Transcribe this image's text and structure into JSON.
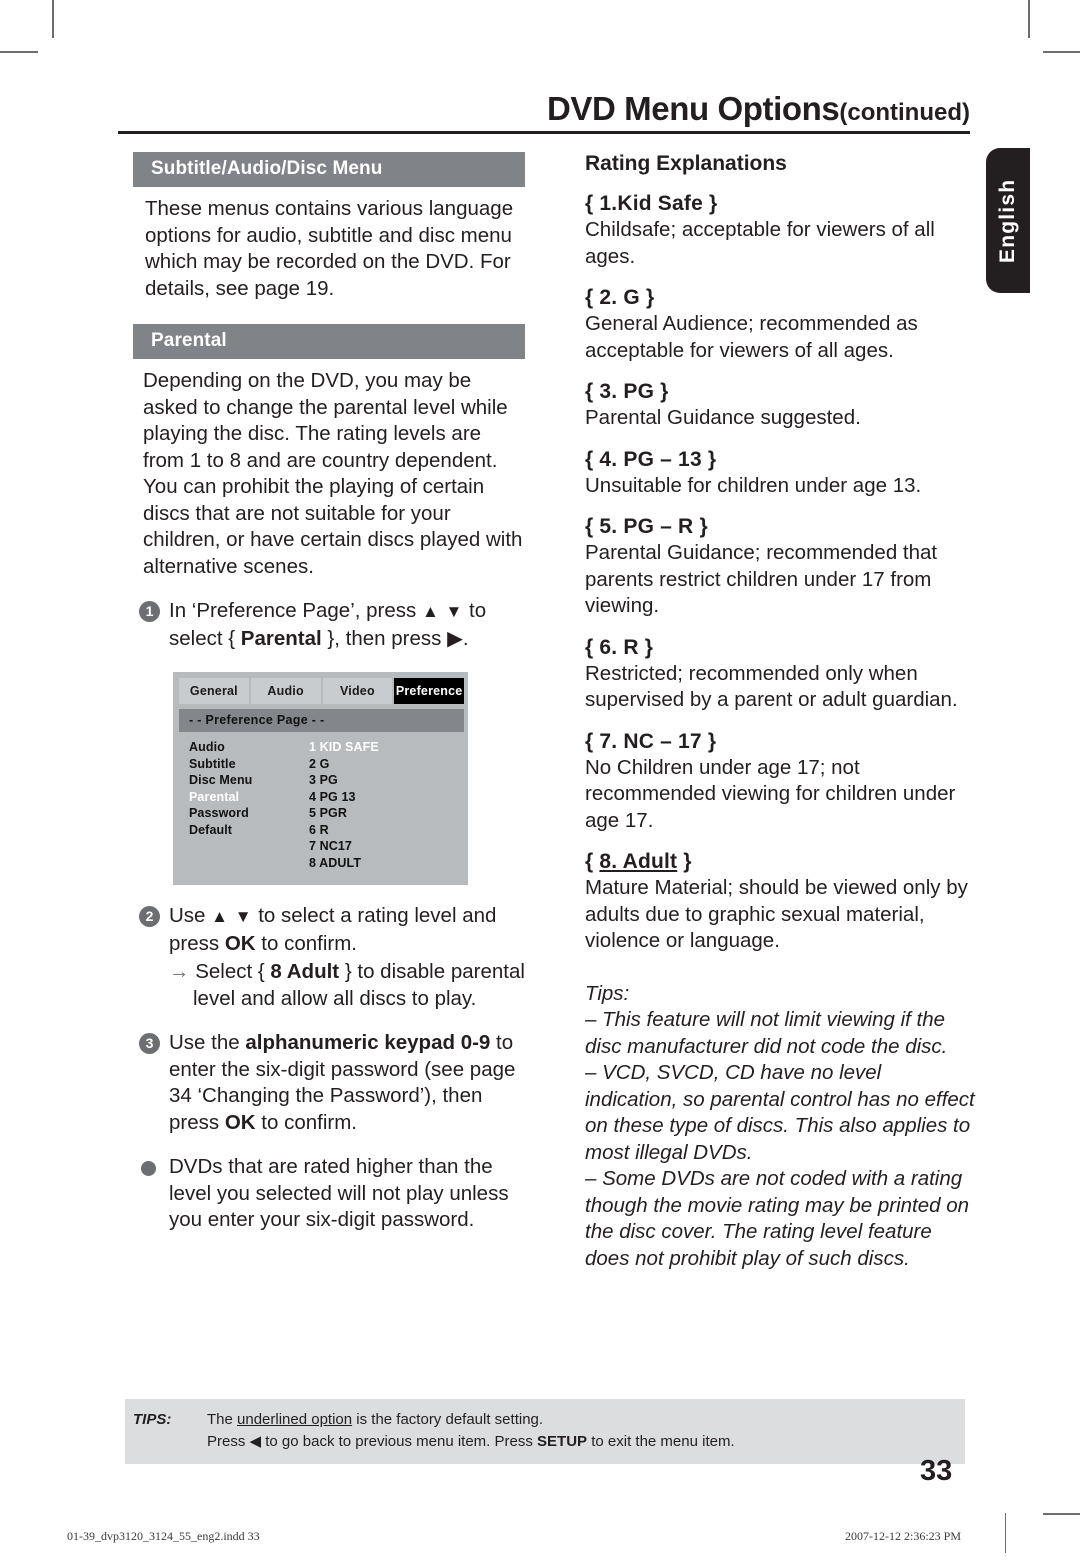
{
  "header": {
    "title": "DVD Menu Options",
    "title_suffix": "(continued)"
  },
  "language_tab": {
    "label": "English"
  },
  "left_column": {
    "section1": {
      "heading": "Subtitle/Audio/Disc Menu",
      "paragraph": "These menus contains various language options for audio, subtitle and disc menu which may be recorded on the DVD. For details, see page 19."
    },
    "section2": {
      "heading": "Parental",
      "paragraph": "Depending on the DVD, you may be asked to change the parental level while playing the disc. The rating levels are from 1 to 8 and are country dependent. You can prohibit the playing of certain discs that are not suitable for your children, or have certain discs played with alternative scenes.",
      "steps": [
        {
          "number": "1",
          "text_before": "In ‘Preference Page’, press ",
          "arrows": "▲ ▼",
          "text_mid": " to select ",
          "brace_open": "{ ",
          "bold_term": "Parental",
          "brace_close": " }, then press ",
          "arrow_right": "▶",
          "text_end": "."
        },
        {
          "number": "2",
          "text_before": "Use ",
          "arrows": "▲ ▼",
          "text_mid": " to select a rating level and press ",
          "bold_term": "OK",
          "text_end": " to confirm.",
          "substep": {
            "arrow": "→",
            "text_before": " Select { ",
            "bold_term": "8 Adult",
            "text_end": " } to disable parental level and allow all discs to play."
          }
        },
        {
          "number": "3",
          "text_before": "Use the ",
          "bold_term": "alphanumeric keypad 0-9",
          "text_mid": " to enter the six-digit password (see page 34 ‘Changing the Password’), then press ",
          "bold_term2": "OK",
          "text_end": " to confirm."
        }
      ],
      "bullet": "DVDs that are rated higher than the level you selected will not play unless you enter your six-digit password."
    },
    "figure": {
      "name": "dvd-preference-page-menu",
      "tabs": [
        "General",
        "Audio",
        "Video",
        "Preference"
      ],
      "active_tab": "Preference",
      "page_bar": "- -  Preference Page   - -",
      "menu_items": [
        "Audio",
        "Subtitle",
        "Disc Menu",
        "Parental",
        "Password",
        "Default"
      ],
      "highlighted_menu_item": "Parental",
      "rating_values": [
        "1 KID SAFE",
        "2 G",
        "3 PG",
        "4 PG 13",
        "5 PGR",
        "6 R",
        "7 NC17",
        "8 ADULT"
      ],
      "highlighted_rating_value": "1 KID SAFE"
    }
  },
  "right_column": {
    "title": "Rating Explanations",
    "ratings": [
      {
        "label_prefix": "{ ",
        "label": "1.Kid Safe",
        "label_suffix": " }",
        "underlined": false,
        "body": "Childsafe; acceptable for viewers of all ages."
      },
      {
        "label_prefix": "{ ",
        "label": "2. G",
        "label_suffix": " }",
        "underlined": false,
        "body": "General Audience; recommended as acceptable for viewers of all ages."
      },
      {
        "label_prefix": "{ ",
        "label": "3. PG",
        "label_suffix": " }",
        "underlined": false,
        "body": "Parental Guidance suggested."
      },
      {
        "label_prefix": "{ ",
        "label": "4. PG – 13",
        "label_suffix": " }",
        "underlined": false,
        "body": "Unsuitable for children under age 13."
      },
      {
        "label_prefix": "{ ",
        "label": "5. PG – R",
        "label_suffix": " }",
        "underlined": false,
        "body": "Parental Guidance; recommended that parents restrict children under 17 from viewing."
      },
      {
        "label_prefix": "{ ",
        "label": "6. R",
        "label_suffix": " }",
        "underlined": false,
        "body": "Restricted; recommended only when supervised by a parent or adult guardian."
      },
      {
        "label_prefix": "{ ",
        "label": "7. NC – 17",
        "label_suffix": " }",
        "underlined": false,
        "body": "No Children under age 17; not recommended viewing for children under age 17."
      },
      {
        "label_prefix": "{ ",
        "label": "8. Adult",
        "label_suffix": " }",
        "underlined": true,
        "body": "Mature Material; should be viewed only by adults due to graphic sexual material, violence or language."
      }
    ],
    "tips": {
      "label": "Tips:",
      "items": [
        "–  This feature will not limit viewing if the disc manufacturer did not code the disc.",
        "–  VCD, SVCD, CD have no level indication, so parental control has no effect on these type of discs. This also applies to most illegal DVDs.",
        "–  Some DVDs are not coded with a rating though the movie rating may be printed on the disc cover. The rating level feature does not prohibit play of such discs."
      ]
    }
  },
  "footer_tips": {
    "label": "TIPS:",
    "line1_before": "The ",
    "line1_underlined": "underlined option",
    "line1_after": " is the factory default setting.",
    "line2_before": "Press ",
    "line2_arrow": "◀",
    "line2_mid": " to go back to previous menu item. Press ",
    "line2_bold": "SETUP",
    "line2_after": " to exit the menu item."
  },
  "page_number": "33",
  "print_footer": {
    "file": "01-39_dvp3120_3124_55_eng2.indd   33",
    "timestamp": "2007-12-12   2:36:23 PM"
  }
}
